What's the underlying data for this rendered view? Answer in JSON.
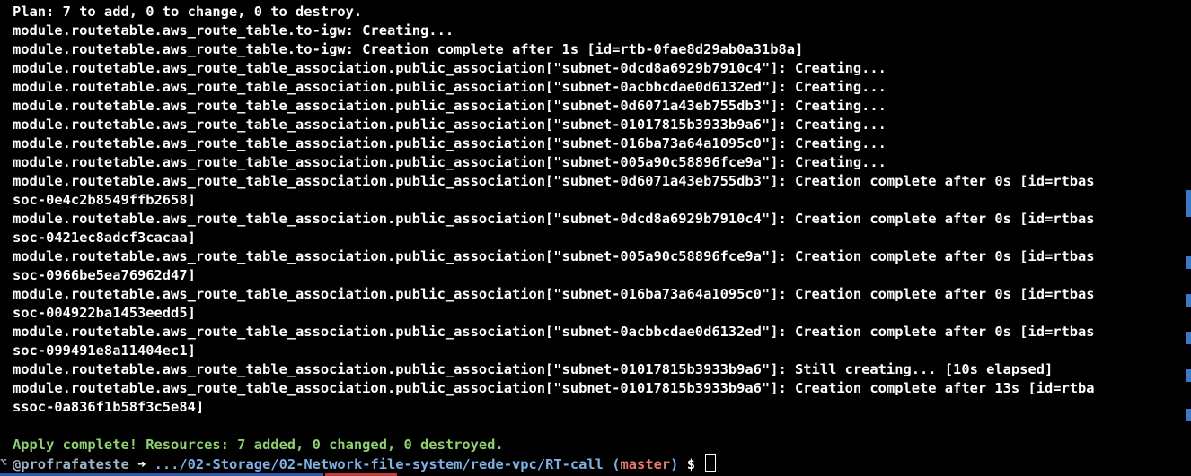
{
  "terminal": {
    "output_lines": [
      "Plan: 7 to add, 0 to change, 0 to destroy.",
      "module.routetable.aws_route_table.to-igw: Creating...",
      "module.routetable.aws_route_table.to-igw: Creation complete after 1s [id=rtb-0fae8d29ab0a31b8a]",
      "module.routetable.aws_route_table_association.public_association[\"subnet-0dcd8a6929b7910c4\"]: Creating...",
      "module.routetable.aws_route_table_association.public_association[\"subnet-0acbbcdae0d6132ed\"]: Creating...",
      "module.routetable.aws_route_table_association.public_association[\"subnet-0d6071a43eb755db3\"]: Creating...",
      "module.routetable.aws_route_table_association.public_association[\"subnet-01017815b3933b9a6\"]: Creating...",
      "module.routetable.aws_route_table_association.public_association[\"subnet-016ba73a64a1095c0\"]: Creating...",
      "module.routetable.aws_route_table_association.public_association[\"subnet-005a90c58896fce9a\"]: Creating...",
      "module.routetable.aws_route_table_association.public_association[\"subnet-0d6071a43eb755db3\"]: Creation complete after 0s [id=rtbas",
      "soc-0e4c2b8549ffb2658]",
      "module.routetable.aws_route_table_association.public_association[\"subnet-0dcd8a6929b7910c4\"]: Creation complete after 0s [id=rtbas",
      "soc-0421ec8adcf3cacaa]",
      "module.routetable.aws_route_table_association.public_association[\"subnet-005a90c58896fce9a\"]: Creation complete after 0s [id=rtbas",
      "soc-0966be5ea76962d47]",
      "module.routetable.aws_route_table_association.public_association[\"subnet-016ba73a64a1095c0\"]: Creation complete after 0s [id=rtbas",
      "soc-004922ba1453eedd5]",
      "module.routetable.aws_route_table_association.public_association[\"subnet-0acbbcdae0d6132ed\"]: Creation complete after 0s [id=rtbas",
      "soc-099491e8a11404ec1]",
      "module.routetable.aws_route_table_association.public_association[\"subnet-01017815b3933b9a6\"]: Still creating... [10s elapsed]",
      "module.routetable.aws_route_table_association.public_association[\"subnet-01017815b3933b9a6\"]: Creation complete after 13s [id=rtba",
      "ssoc-0a836f1b58f3c5e84]",
      ""
    ],
    "summary_line": "Apply complete! Resources: 7 added, 0 changed, 0 destroyed.",
    "prompt": {
      "icon": "git-prompt-icon",
      "icon_glyph": "⌥",
      "user": "@profrafateste",
      "arrow": "➜",
      "path": ".../02-Storage/02-Network-file-system/rede-vpc/RT-call",
      "branch_open": "(",
      "branch": "master",
      "branch_close": ")",
      "symbol": "$"
    },
    "colors": {
      "background": "#000000",
      "text": "#ffffff",
      "success": "#8fd170",
      "path": "#7fb0e6",
      "branch": "#e97a6e",
      "scroll_marker": "#3a78c8"
    }
  }
}
